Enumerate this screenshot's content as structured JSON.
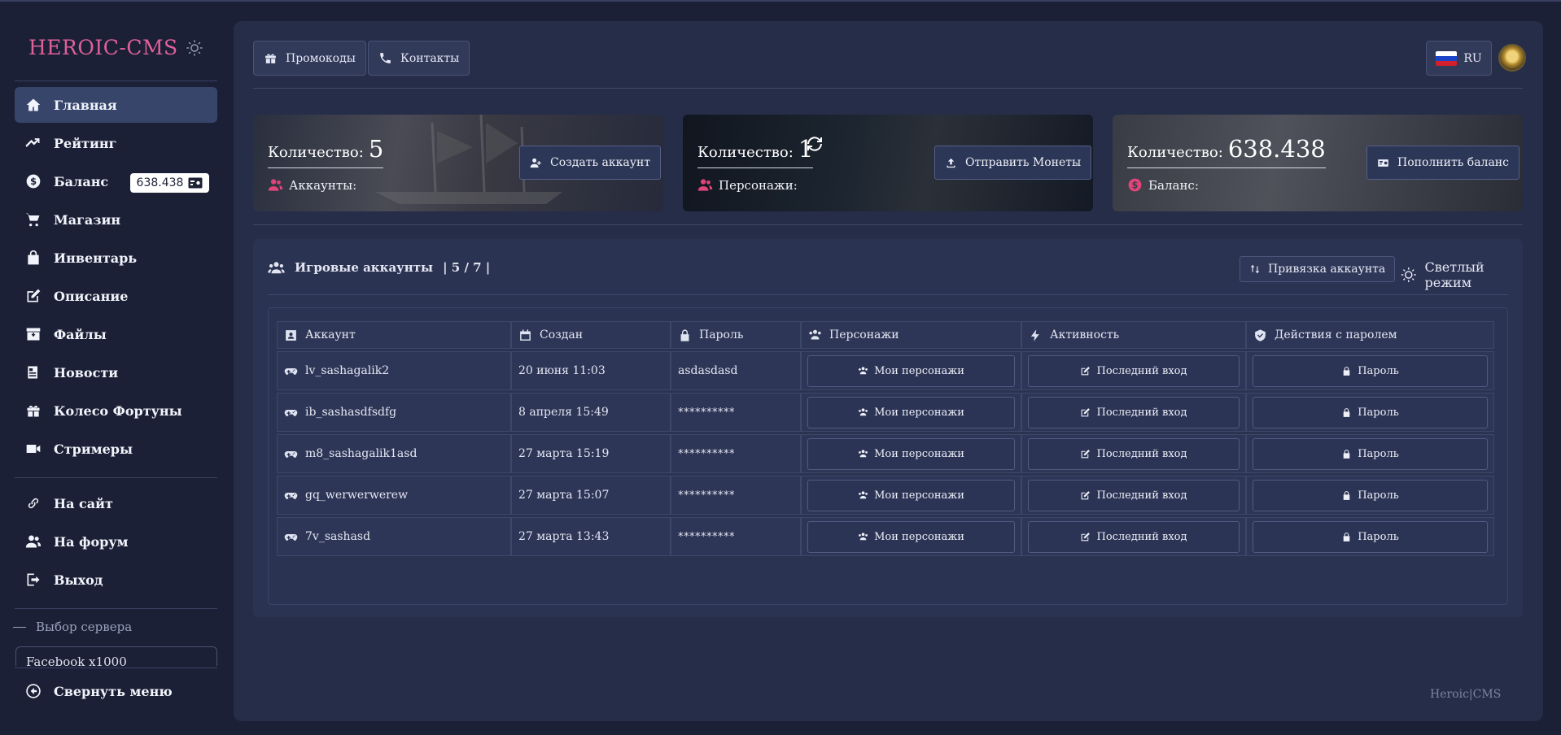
{
  "sidebar": {
    "brand": "HEROIC-CMS",
    "items": [
      {
        "label": "Главная"
      },
      {
        "label": "Рейтинг"
      },
      {
        "label": "Баланс"
      },
      {
        "label": "Магазин"
      },
      {
        "label": "Инвентарь"
      },
      {
        "label": "Описание"
      },
      {
        "label": "Файлы"
      },
      {
        "label": "Новости"
      },
      {
        "label": "Колесо Фортуны"
      },
      {
        "label": "Стримеры"
      }
    ],
    "links": [
      {
        "label": "На сайт"
      },
      {
        "label": "На форум"
      },
      {
        "label": "Выход"
      }
    ],
    "balance_badge": "638.438",
    "server_label": "Выбор сервера",
    "server_value": "Facebook x1000",
    "collapse": "Свернуть меню"
  },
  "header": {
    "promo": "Промокоды",
    "contacts": "Контакты",
    "lang": "RU"
  },
  "stats": [
    {
      "title": "Количество:",
      "value": "5",
      "sub": "Аккаунты:",
      "button": "Создать аккаунт"
    },
    {
      "title": "Количество:",
      "value": "1",
      "sub": "Персонажи:",
      "button": "Отправить Монеты"
    },
    {
      "title": "Количество:",
      "value": "638.438",
      "sub": "Баланс:",
      "button": "Пополнить баланс"
    }
  ],
  "accounts": {
    "title": "Игровые аккаунты",
    "count": "| 5 / 7 |",
    "bind_button": "Привязка аккаунта",
    "light_mode": "Светлый режим",
    "headers": [
      "Аккаунт",
      "Создан",
      "Пароль",
      "Персонажи",
      "Активность",
      "Действия с паролем"
    ],
    "rows": [
      {
        "account": "lv_sashagalik2",
        "created": "20 июня 11:03",
        "password": "asdasdasd"
      },
      {
        "account": "ib_sashasdfsdfg",
        "created": "8 апреля 15:49",
        "password": "**********"
      },
      {
        "account": "m8_sashagalik1asd",
        "created": "27 марта 15:19",
        "password": "**********"
      },
      {
        "account": "gq_werwerwerew",
        "created": "27 марта 15:07",
        "password": "**********"
      },
      {
        "account": "7v_sashasd",
        "created": "27 марта 13:43",
        "password": "**********"
      }
    ],
    "btn_chars": "Мои персонажи",
    "btn_last": "Последний вход",
    "btn_pwd": "Пароль"
  },
  "footer": "Heroic|CMS",
  "colors": {
    "brand": "#e0609a",
    "bg": "#1b2036",
    "panel": "#262d48",
    "accent_pink": "#e0457a"
  }
}
